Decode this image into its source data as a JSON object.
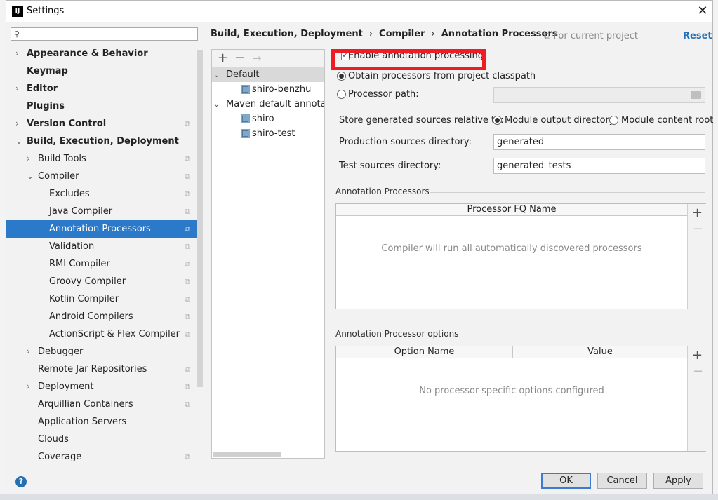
{
  "window": {
    "title": "Settings",
    "logo": "IJ"
  },
  "search": {
    "placeholder": ""
  },
  "sidebar": {
    "items": [
      {
        "label": "Appearance & Behavior",
        "bold": true,
        "arrow": "›",
        "indent": 0,
        "proj": false
      },
      {
        "label": "Keymap",
        "bold": true,
        "arrow": "",
        "indent": 0,
        "proj": false
      },
      {
        "label": "Editor",
        "bold": true,
        "arrow": "›",
        "indent": 0,
        "proj": false
      },
      {
        "label": "Plugins",
        "bold": true,
        "arrow": "",
        "indent": 0,
        "proj": false
      },
      {
        "label": "Version Control",
        "bold": true,
        "arrow": "›",
        "indent": 0,
        "proj": true
      },
      {
        "label": "Build, Execution, Deployment",
        "bold": true,
        "arrow": "⌄",
        "indent": 0,
        "proj": false
      },
      {
        "label": "Build Tools",
        "bold": false,
        "arrow": "›",
        "indent": 1,
        "proj": true
      },
      {
        "label": "Compiler",
        "bold": false,
        "arrow": "⌄",
        "indent": 1,
        "proj": true
      },
      {
        "label": "Excludes",
        "bold": false,
        "arrow": "",
        "indent": 2,
        "proj": true
      },
      {
        "label": "Java Compiler",
        "bold": false,
        "arrow": "",
        "indent": 2,
        "proj": true
      },
      {
        "label": "Annotation Processors",
        "bold": false,
        "arrow": "",
        "indent": 2,
        "proj": true,
        "selected": true
      },
      {
        "label": "Validation",
        "bold": false,
        "arrow": "",
        "indent": 2,
        "proj": true
      },
      {
        "label": "RMI Compiler",
        "bold": false,
        "arrow": "",
        "indent": 2,
        "proj": true
      },
      {
        "label": "Groovy Compiler",
        "bold": false,
        "arrow": "",
        "indent": 2,
        "proj": true
      },
      {
        "label": "Kotlin Compiler",
        "bold": false,
        "arrow": "",
        "indent": 2,
        "proj": true
      },
      {
        "label": "Android Compilers",
        "bold": false,
        "arrow": "",
        "indent": 2,
        "proj": true
      },
      {
        "label": "ActionScript & Flex Compiler",
        "bold": false,
        "arrow": "",
        "indent": 2,
        "proj": true
      },
      {
        "label": "Debugger",
        "bold": false,
        "arrow": "›",
        "indent": 1,
        "proj": false
      },
      {
        "label": "Remote Jar Repositories",
        "bold": false,
        "arrow": "",
        "indent": 1,
        "proj": true
      },
      {
        "label": "Deployment",
        "bold": false,
        "arrow": "›",
        "indent": 1,
        "proj": true
      },
      {
        "label": "Arquillian Containers",
        "bold": false,
        "arrow": "",
        "indent": 1,
        "proj": true
      },
      {
        "label": "Application Servers",
        "bold": false,
        "arrow": "",
        "indent": 1,
        "proj": false
      },
      {
        "label": "Clouds",
        "bold": false,
        "arrow": "",
        "indent": 1,
        "proj": false
      },
      {
        "label": "Coverage",
        "bold": false,
        "arrow": "",
        "indent": 1,
        "proj": true
      }
    ]
  },
  "breadcrumb": [
    "Build, Execution, Deployment",
    "Compiler",
    "Annotation Processors"
  ],
  "header": {
    "for_current_project": "For current project",
    "reset": "Reset"
  },
  "profiles": {
    "toolbar": {
      "add": "+",
      "remove": "−",
      "move": "→"
    },
    "items": [
      {
        "label": "Default",
        "arrow": "⌄",
        "level": 0,
        "icon": false,
        "selected": true
      },
      {
        "label": "shiro-benzhu",
        "arrow": "",
        "level": 1,
        "icon": true
      },
      {
        "label": "Maven default annotation processors profile",
        "arrow": "⌄",
        "level": 0,
        "icon": false
      },
      {
        "label": "shiro",
        "arrow": "",
        "level": 1,
        "icon": true
      },
      {
        "label": "shiro-test",
        "arrow": "",
        "level": 1,
        "icon": true
      }
    ]
  },
  "settings": {
    "enable_label": "Enable annotation processing",
    "enable_checked": true,
    "obtain_label": "Obtain processors from project classpath",
    "processor_path_label": "Processor path:",
    "processor_path_value": "",
    "store_label": "Store generated sources relative to:",
    "module_output_label": "Module output directory",
    "module_content_label": "Module content root",
    "production_label": "Production sources directory:",
    "production_value": "generated",
    "test_label": "Test sources directory:",
    "test_value": "generated_tests"
  },
  "processors": {
    "title": "Annotation Processors",
    "column": "Processor FQ Name",
    "empty": "Compiler will run all automatically discovered processors"
  },
  "options": {
    "title": "Annotation Processor options",
    "columns": [
      "Option Name",
      "Value"
    ],
    "empty": "No processor-specific options configured"
  },
  "buttons": {
    "help": "?",
    "ok": "OK",
    "cancel": "Cancel",
    "apply": "Apply"
  }
}
